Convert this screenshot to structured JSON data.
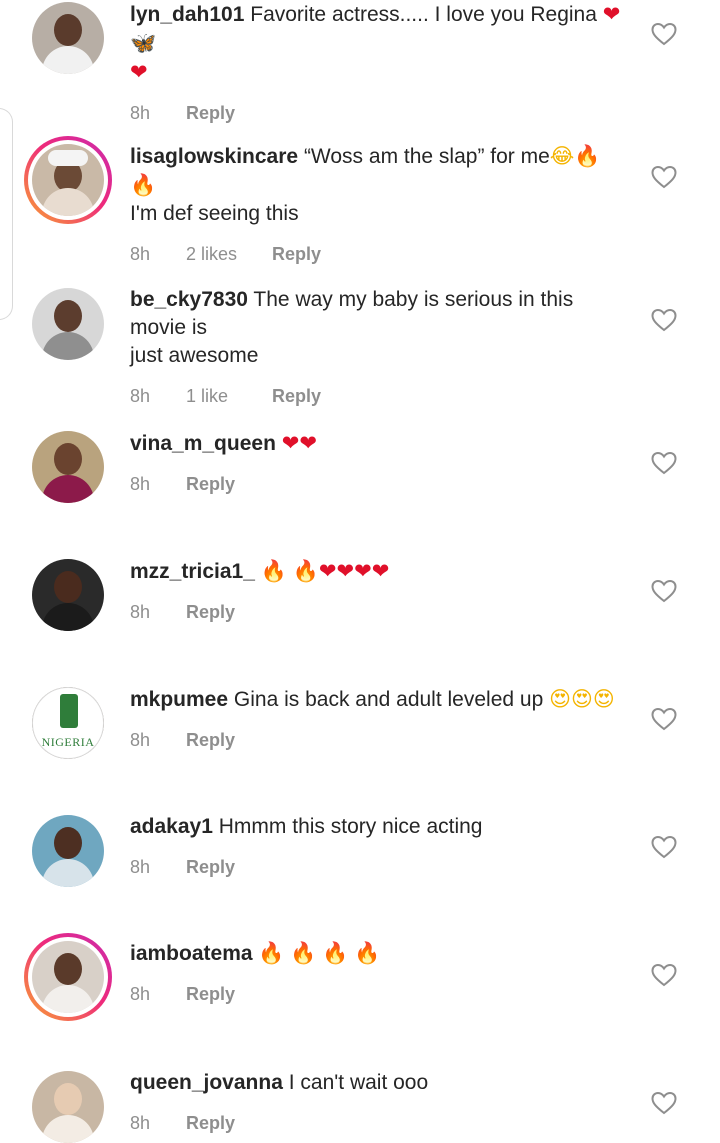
{
  "comments": [
    {
      "username": "lyn_dah101",
      "text": "Favorite actress..... I love you Regina",
      "emojis": [
        "❤",
        "🦋",
        "❤"
      ],
      "time": "8h",
      "likes": "",
      "reply": "Reply"
    },
    {
      "username": "lisaglowskincare",
      "text": "“Woss am the slap” for me",
      "emojis": [
        "😂",
        "🔥",
        "🔥"
      ],
      "text2": "I'm def seeing this",
      "time": "8h",
      "likes": "2 likes",
      "reply": "Reply"
    },
    {
      "username": "be_cky7830",
      "text": "The way my baby is serious in this movie is",
      "text2": "just awesome",
      "time": "8h",
      "likes": "1 like",
      "reply": "Reply"
    },
    {
      "username": "vina_m_queen",
      "text": "",
      "emojis": [
        "❤",
        "❤"
      ],
      "time": "8h",
      "likes": "",
      "reply": "Reply"
    },
    {
      "username": "mzz_tricia1_",
      "text": "",
      "emojis": [
        "🔥",
        "🔥",
        "❤",
        "❤",
        "❤",
        "❤"
      ],
      "time": "8h",
      "likes": "",
      "reply": "Reply"
    },
    {
      "username": "mkpumee",
      "text": "Gina is back and adult leveled up",
      "emojis": [
        "😍",
        "😍",
        "😍"
      ],
      "avatar_text": "NIGERIA",
      "time": "8h",
      "likes": "",
      "reply": "Reply"
    },
    {
      "username": "adakay1",
      "text": "Hmmm this story nice acting",
      "time": "8h",
      "likes": "",
      "reply": "Reply"
    },
    {
      "username": "iamboatema",
      "text": "",
      "emojis": [
        "🔥",
        "🔥",
        "🔥",
        "🔥"
      ],
      "time": "8h",
      "likes": "",
      "reply": "Reply"
    },
    {
      "username": "queen_jovanna",
      "text": "I can't wait ooo",
      "time": "8h",
      "likes": "",
      "reply": "Reply"
    }
  ],
  "icons": {
    "like": "heart-outline-icon"
  },
  "colors": {
    "text": "#262626",
    "meta": "#8e8e8e",
    "story_ring_start": "#f9a532",
    "story_ring_end": "#c92bb0"
  }
}
